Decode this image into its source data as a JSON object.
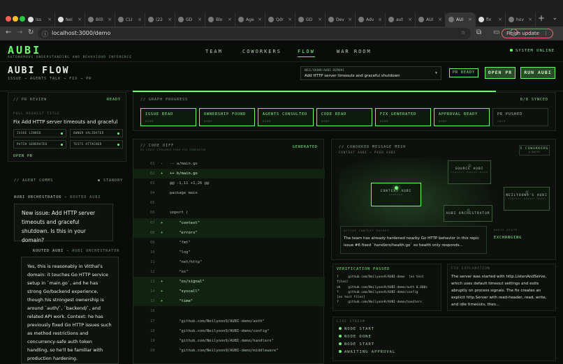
{
  "browser": {
    "tabs": [
      {
        "label": "Iss",
        "icon": "github-icon"
      },
      {
        "label": "Nei",
        "icon": "github-icon"
      },
      {
        "label": "Billi",
        "icon": "page-icon"
      },
      {
        "label": "CLI",
        "icon": "page-icon"
      },
      {
        "label": "(22",
        "icon": "whatsapp-icon"
      },
      {
        "label": "GD",
        "icon": "page-icon"
      },
      {
        "label": "Blo",
        "icon": "page-icon"
      },
      {
        "label": "Age",
        "icon": "page-icon"
      },
      {
        "label": "Qdr",
        "icon": "page-icon"
      },
      {
        "label": "GD",
        "icon": "page-icon"
      },
      {
        "label": "Dev",
        "icon": "page-icon"
      },
      {
        "label": "Adv",
        "icon": "page-icon"
      },
      {
        "label": "aut",
        "icon": "page-icon"
      },
      {
        "label": "AUI",
        "icon": "page-icon"
      },
      {
        "label": "AUI",
        "icon": "page-icon",
        "active": true
      },
      {
        "label": "fix",
        "icon": "github-icon"
      },
      {
        "label": "hov",
        "icon": "page-icon"
      }
    ],
    "url": "localhost:3000/demo",
    "finish_update": "Finish update"
  },
  "app": {
    "brand": "AUBI",
    "brand_sub": "AUTONOMOUS UNDERSTANDING AND BEHAVIOUR INFERENCE",
    "nav": [
      "TEAM",
      "COWORKERS",
      "FLOW",
      "WAR ROOM"
    ],
    "system_status": "SYSTEM ONLINE",
    "flow_title": "AUBI FLOW",
    "flow_sub": "ISSUE → AGENTS TALK → FIX → PR",
    "repo_owner": "NEILYOON9/AUBI-DEMO#1",
    "repo_issue": "Add HTTP server timeouts and graceful shutdown",
    "pr_ready": "PR READY",
    "open_pr": "OPEN PR",
    "run_aubi": "RUN AUBI"
  },
  "pr_review": {
    "header": "// PR REVIEW",
    "status": "READY",
    "title_label": "PULL REQUEST TITLE",
    "title": "Fix Add HTTP server timeouts and graceful",
    "checks": [
      "ISSUE LINKED",
      "OWNER VALIDATED",
      "PATCH GENERATED",
      "TESTS ATTACHED"
    ],
    "open_pr": "OPEN PR"
  },
  "agent_comms": {
    "header": "// AGENT COMMS",
    "standby": "● STANDBY",
    "msg1_from": "AUBI ORCHESTRATOR",
    "msg1_to": "→ ROUTED AUBI",
    "msg1": "New issue: Add HTTP server timeouts and graceful shutdown. Is this in your domain?",
    "msg2_from": "ROUTED AUBI",
    "msg2_to": "→ AUBI ORCHESTRATOR",
    "msg2": "Yes, this is reasonably in Vitthal's domain: it touches Go HTTP service setup in `main.go`, and he has strong Go/backend experience, though his strongest ownership is around `auth/`, `backend/`, and related API work. Context: he has previously fixed Go HTTP issues such as method restrictions and concurrency-safe auth token handling, so he'll be familiar with production hardening."
  },
  "graph": {
    "header": "// GRAPH PROGRESS",
    "synced": "8/8 SYNCED",
    "nodes": [
      {
        "label": "ISSUE READ",
        "state": "DONE"
      },
      {
        "label": "OWNERSHIP FOUND",
        "state": "DONE"
      },
      {
        "label": "AGENTS CONSULTED",
        "state": "DONE"
      },
      {
        "label": "CODE READ",
        "state": "DONE"
      },
      {
        "label": "FIX GENERATED",
        "state": "DONE"
      },
      {
        "label": "APPROVAL READY",
        "state": "DONE"
      },
      {
        "label": "PR PUSHED",
        "state": "IDLE"
      }
    ]
  },
  "diff": {
    "header": "// CODE DIFF",
    "sub": "80 LINES STREAMED FROM FIX GENERATOR",
    "status": "GENERATED",
    "lines": [
      {
        "n": "01",
        "m": "-",
        "t": "-- a/main.go",
        "add": false
      },
      {
        "n": "02",
        "m": "+",
        "t": "++ b/main.go",
        "add": true
      },
      {
        "n": "03",
        "m": "",
        "t": "@@ -1,11 +1,26 @@",
        "add": false
      },
      {
        "n": "04",
        "m": "",
        "t": "package main",
        "add": false
      },
      {
        "n": "05",
        "m": "",
        "t": "",
        "add": false
      },
      {
        "n": "06",
        "m": "",
        "t": "import (",
        "add": false
      },
      {
        "n": "07",
        "m": "+",
        "t": "    \"context\"",
        "add": true
      },
      {
        "n": "08",
        "m": "+",
        "t": "    \"errors\"",
        "add": true
      },
      {
        "n": "09",
        "m": "",
        "t": "    \"fmt\"",
        "add": false
      },
      {
        "n": "10",
        "m": "",
        "t": "    \"log\"",
        "add": false
      },
      {
        "n": "11",
        "m": "",
        "t": "    \"net/http\"",
        "add": false
      },
      {
        "n": "12",
        "m": "",
        "t": "    \"os\"",
        "add": false
      },
      {
        "n": "13",
        "m": "+",
        "t": "    \"os/signal\"",
        "add": true
      },
      {
        "n": "14",
        "m": "+",
        "t": "    \"syscall\"",
        "add": true
      },
      {
        "n": "15",
        "m": "+",
        "t": "    \"time\"",
        "add": true
      },
      {
        "n": "16",
        "m": "",
        "t": "",
        "add": false
      },
      {
        "n": "17",
        "m": "",
        "t": "    \"github.com/Neilyoon9/AUBI-demo/auth\"",
        "add": false
      },
      {
        "n": "18",
        "m": "",
        "t": "    \"github.com/Neilyoon9/AUBI-demo/config\"",
        "add": false
      },
      {
        "n": "19",
        "m": "",
        "t": "    \"github.com/Neilyoon9/AUBI-demo/handlers\"",
        "add": false
      },
      {
        "n": "20",
        "m": "",
        "t": "    \"github.com/Neilyoon9/AUBI-demo/middleware\"",
        "add": false
      }
    ]
  },
  "mesh": {
    "header": "// COWORKER MESSAGE MESH",
    "sub": "CONTEXT AUBI → PEER AUBI",
    "count": "5 COWORKERS",
    "count_sub": "8 ROUTES",
    "nodes": {
      "context": {
        "title": "CONTEXT AUBI",
        "sub": "SENDING"
      },
      "source": {
        "title": "SOURCE AUBI",
        "sub": "CONTEXT MEMORY NODE"
      },
      "neil": {
        "title": "NEILYOON9'S AUBI",
        "sub": "CONTEXT MEMORY NODE"
      },
      "orchestrator": {
        "title": "AUBI ORCHESTRATOR",
        "sub": ""
      }
    },
    "packet_label": "ACTIVE CONTEXT PACKET",
    "packet": "The team has already hardened nearby Go HTTP behavior in this repo: issue #6 fixed `handlers/health.go` so health only responds...",
    "route_label": "ROUTE STATE",
    "route_state": "EXCHANGING"
  },
  "verification": {
    "header": "VERIFICATION PASSED",
    "output": "?     github.com/Neilyoon9/AUBI-demo  [no test\nfiles]\nok    github.com/Neilyoon9/AUBI-demo/auth 0.680s\n?     github.com/Neilyoon9/AUBI-demo/config\n[no test files]\n?     github.com/Neilyoon9/AUBI-demo/handlers"
  },
  "fix_explanation": {
    "header": "FIX EXPLANATION",
    "text": "The server was started with http.ListenAndServe, which uses default timeout settings and exits abruptly on process signals. The fix creates an explicit http.Server with read-header, read, write, and idle timeouts, then..."
  },
  "live_stream": {
    "header": "LIVE STREAM",
    "items": [
      "NODE START",
      "NODE DONE",
      "NODE START",
      "AWAITING APPROVAL"
    ]
  }
}
